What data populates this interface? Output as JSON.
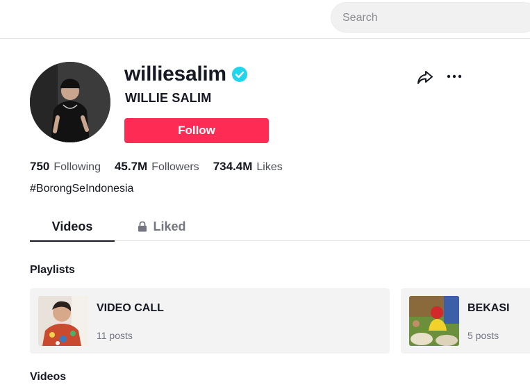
{
  "search": {
    "placeholder": "Search"
  },
  "profile": {
    "username": "williesalim",
    "nickname": "WILLIE SALIM",
    "verified": true,
    "follow_label": "Follow",
    "bio": "#BorongSeIndonesia"
  },
  "stats": [
    {
      "value": "750",
      "label": "Following"
    },
    {
      "value": "45.7M",
      "label": "Followers"
    },
    {
      "value": "734.4M",
      "label": "Likes"
    }
  ],
  "tabs": [
    {
      "label": "Videos",
      "active": true
    },
    {
      "label": "Liked",
      "active": false,
      "locked": true
    }
  ],
  "sections": {
    "playlists": "Playlists",
    "videos": "Videos"
  },
  "playlists": [
    {
      "title": "VIDEO CALL",
      "count": "11 posts"
    },
    {
      "title": "BEKASI",
      "count": "5 posts"
    }
  ],
  "colors": {
    "accent": "#fe2c55",
    "verified": "#20d5ec",
    "text": "#161823",
    "muted": "#737580"
  },
  "icons": [
    "verified-badge-icon",
    "share-icon",
    "more-options-icon",
    "lock-icon"
  ]
}
